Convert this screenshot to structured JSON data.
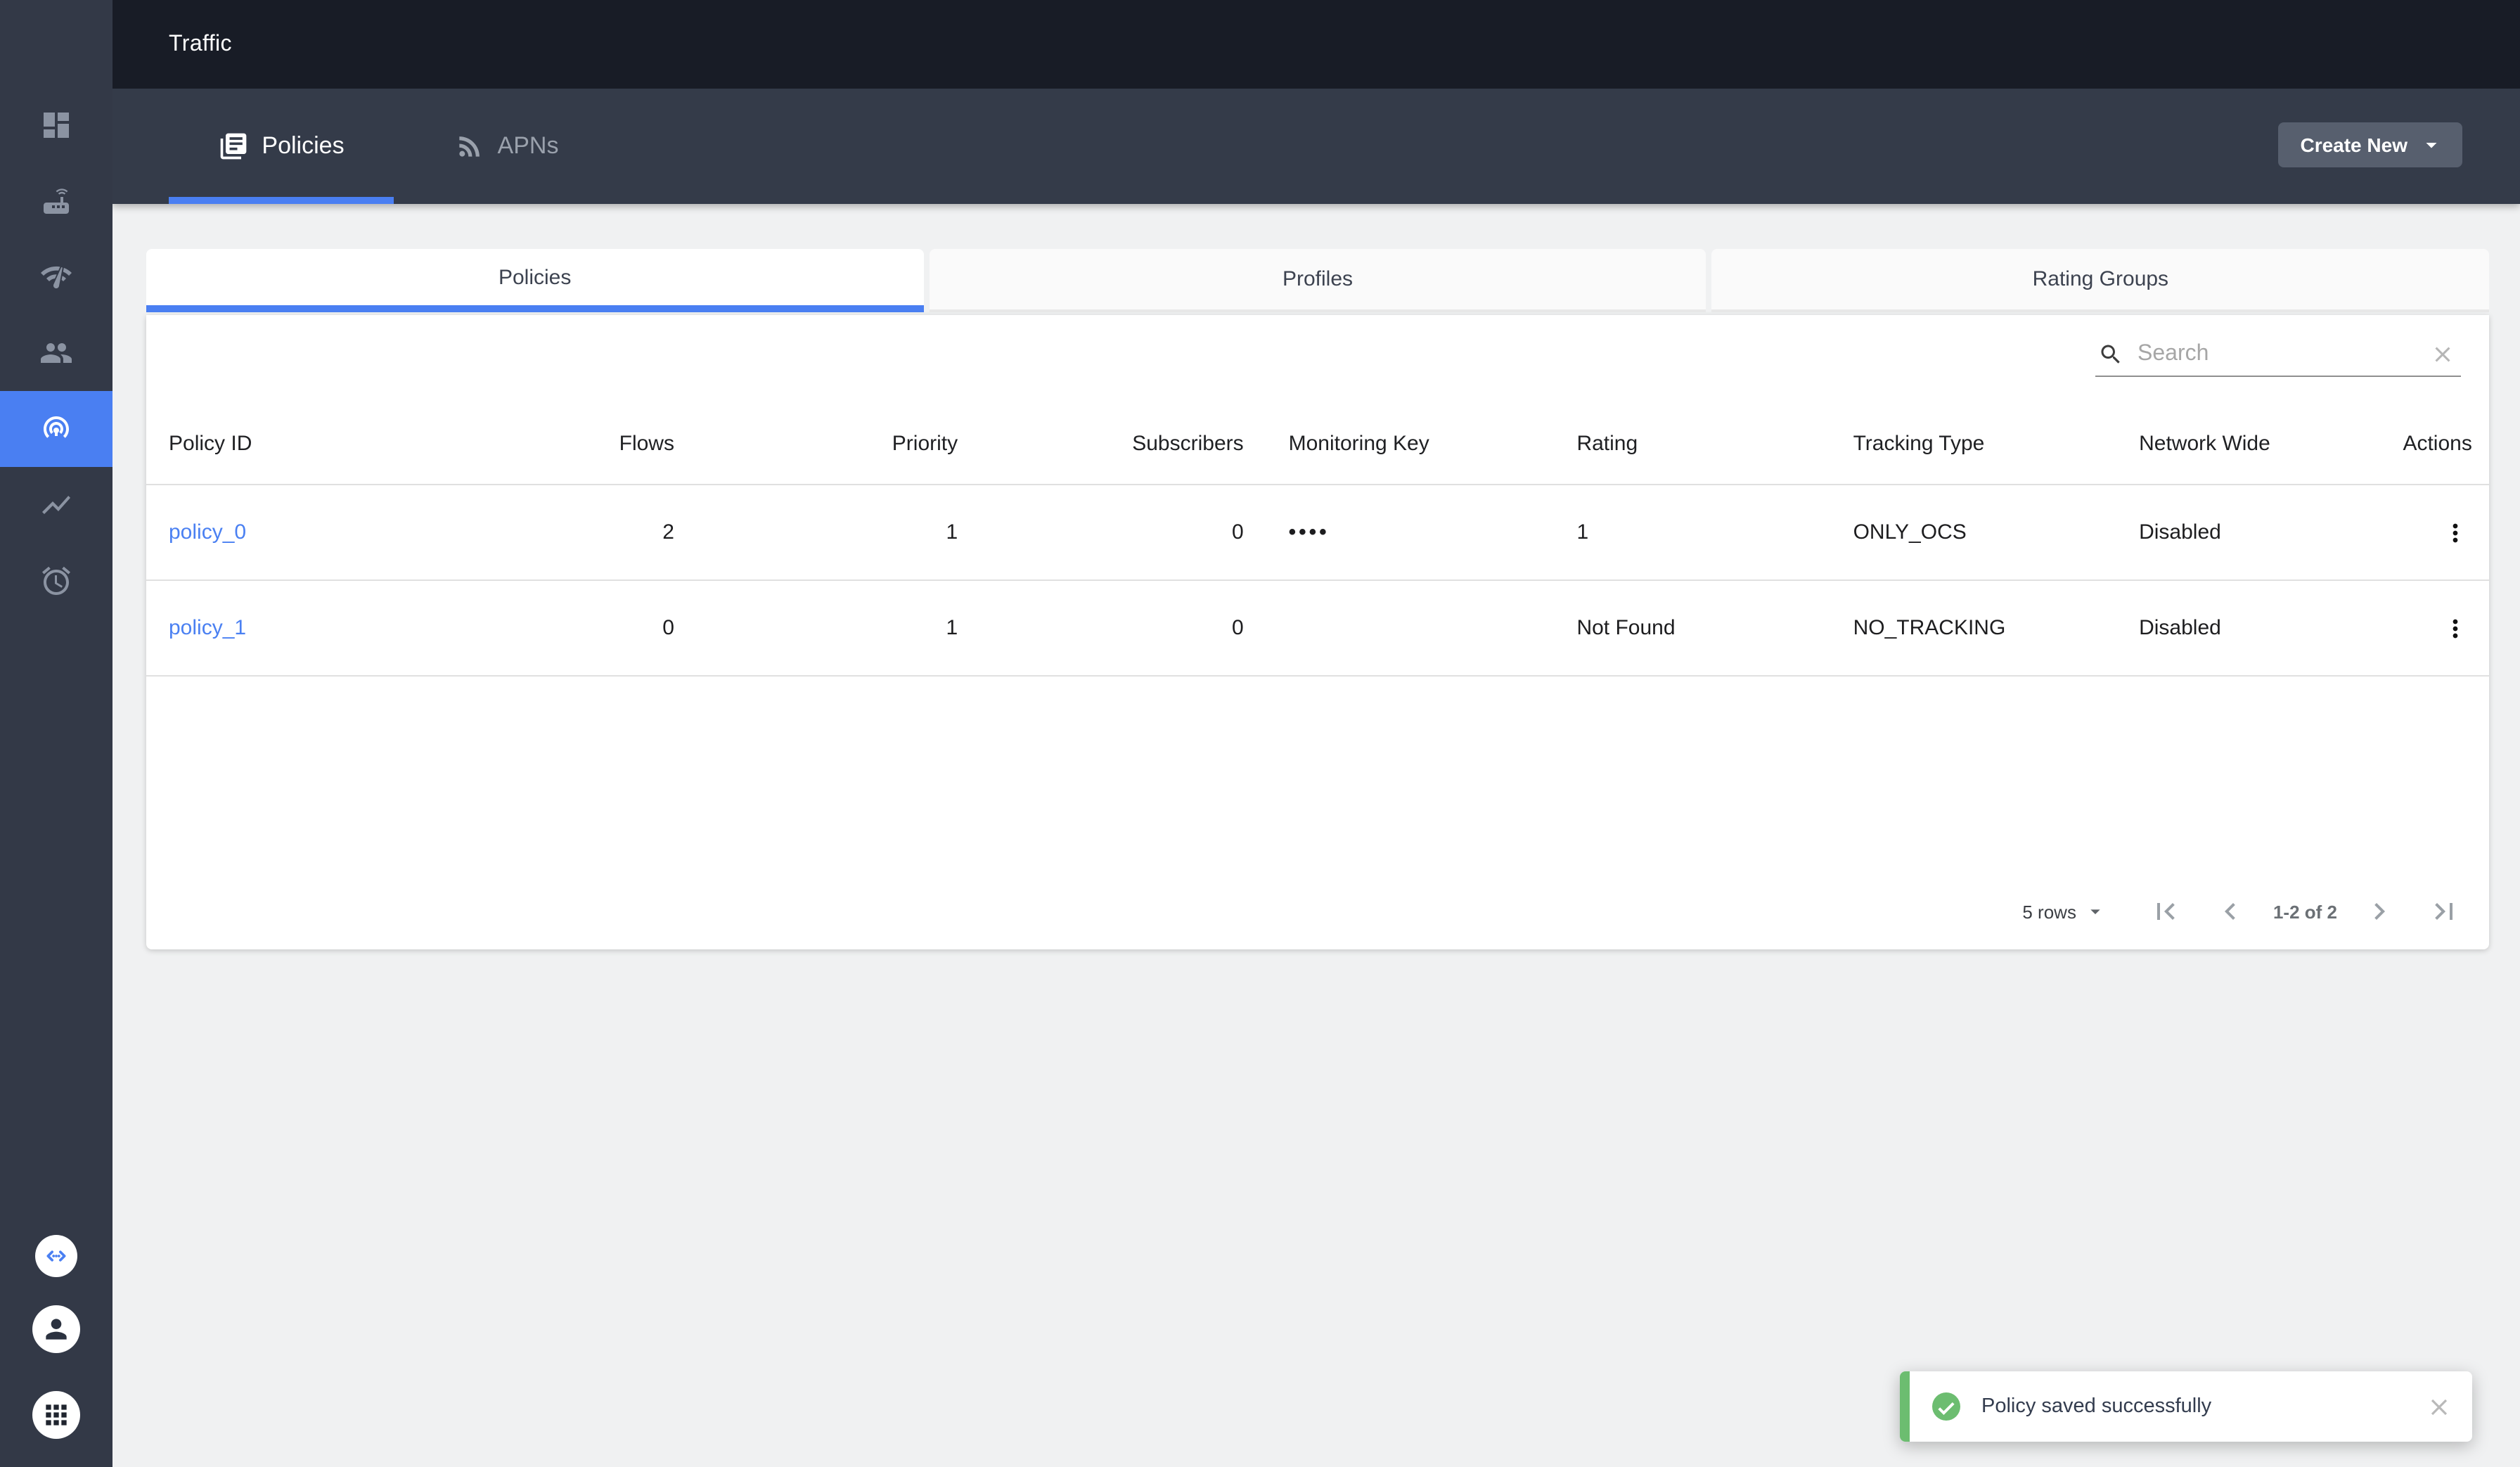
{
  "colors": {
    "accent_blue": "#4a7ff2",
    "link_blue": "#4a80f2",
    "topbar_bg": "#181c26",
    "tabbar_bg": "#343b49",
    "sidebar_bg": "#333947",
    "button_bg": "#575f6e",
    "success_green": "#6cbd70",
    "page_bg": "#f0f1f2"
  },
  "topbar": {
    "title": "Traffic"
  },
  "nav_tabs": {
    "items": [
      {
        "label": "Policies",
        "icon": "library-books-icon",
        "active": true
      },
      {
        "label": "APNs",
        "icon": "rss-feed-icon",
        "active": false
      }
    ],
    "create_button_label": "Create New"
  },
  "sidebar": {
    "items": [
      {
        "icon": "dashboard-icon",
        "selected": false
      },
      {
        "icon": "router-icon",
        "selected": false
      },
      {
        "icon": "network-check-icon",
        "selected": false
      },
      {
        "icon": "people-icon",
        "selected": false
      },
      {
        "icon": "wifi-tethering-icon",
        "selected": true
      },
      {
        "icon": "show-chart-icon",
        "selected": false
      },
      {
        "icon": "alarm-icon",
        "selected": false
      }
    ],
    "bottom_items": [
      {
        "icon": "api-code-icon"
      },
      {
        "icon": "account-icon"
      },
      {
        "icon": "apps-grid-icon"
      }
    ]
  },
  "subtabs": {
    "items": [
      {
        "label": "Policies",
        "active": true
      },
      {
        "label": "Profiles",
        "active": false
      },
      {
        "label": "Rating Groups",
        "active": false
      }
    ]
  },
  "search": {
    "placeholder": "Search"
  },
  "table": {
    "columns": [
      {
        "key": "policy_id",
        "label": "Policy ID",
        "align": "left"
      },
      {
        "key": "flows",
        "label": "Flows",
        "align": "right"
      },
      {
        "key": "priority",
        "label": "Priority",
        "align": "right"
      },
      {
        "key": "subscribers",
        "label": "Subscribers",
        "align": "right"
      },
      {
        "key": "monitoring_key",
        "label": "Monitoring Key",
        "align": "left"
      },
      {
        "key": "rating",
        "label": "Rating",
        "align": "left"
      },
      {
        "key": "tracking_type",
        "label": "Tracking Type",
        "align": "left"
      },
      {
        "key": "network_wide",
        "label": "Network Wide",
        "align": "left"
      },
      {
        "key": "actions",
        "label": "Actions",
        "align": "right"
      }
    ],
    "rows": [
      {
        "policy_id": "policy_0",
        "flows": "2",
        "priority": "1",
        "subscribers": "0",
        "monitoring_key": "••••",
        "rating": "1",
        "tracking_type": "ONLY_OCS",
        "network_wide": "Disabled"
      },
      {
        "policy_id": "policy_1",
        "flows": "0",
        "priority": "1",
        "subscribers": "0",
        "monitoring_key": "",
        "rating": "Not Found",
        "tracking_type": "NO_TRACKING",
        "network_wide": "Disabled"
      }
    ]
  },
  "pagination": {
    "rows_per_page": "5 rows",
    "range_label": "1-2 of 2"
  },
  "toast": {
    "message": "Policy saved successfully"
  }
}
